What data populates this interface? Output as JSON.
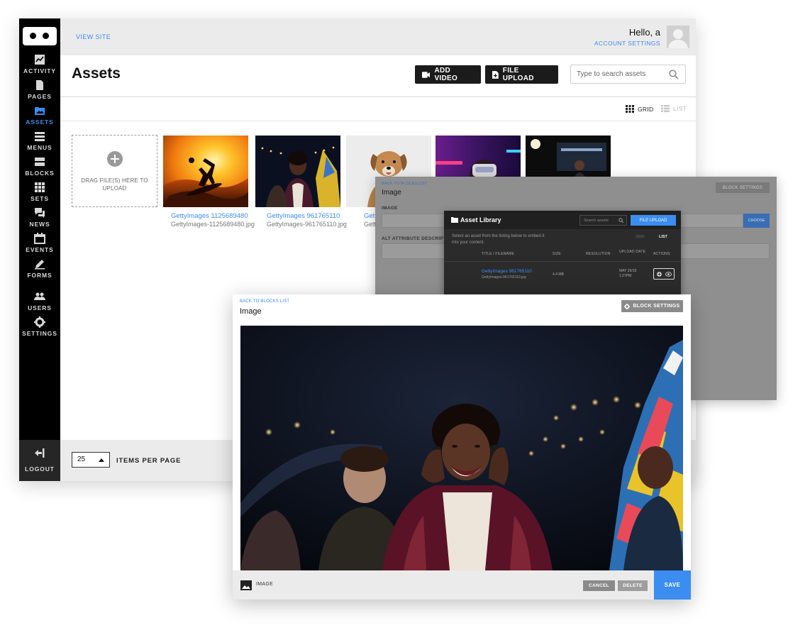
{
  "sidebar": {
    "items": [
      {
        "label": "ACTIVITY",
        "icon": "activity-icon"
      },
      {
        "label": "PAGES",
        "icon": "page-icon"
      },
      {
        "label": "ASSETS",
        "icon": "image-icon",
        "active": true
      },
      {
        "label": "MENUS",
        "icon": "menu-icon"
      },
      {
        "label": "BLOCKS",
        "icon": "blocks-icon"
      },
      {
        "label": "SETS",
        "icon": "grid-icon"
      },
      {
        "label": "NEWS",
        "icon": "chat-icon"
      },
      {
        "label": "EVENTS",
        "icon": "calendar-icon"
      },
      {
        "label": "FORMS",
        "icon": "pencil-icon"
      },
      {
        "label": "USERS",
        "icon": "users-icon"
      },
      {
        "label": "SETTINGS",
        "icon": "gear-icon"
      }
    ],
    "logout": "LOGOUT"
  },
  "topbar": {
    "view_site": "VIEW SITE",
    "greeting": "Hello, a",
    "account_settings": "ACCOUNT SETTINGS"
  },
  "header": {
    "title": "Assets",
    "add_video": "ADD VIDEO",
    "file_upload": "FILE UPLOAD",
    "search_placeholder": "Type to search assets"
  },
  "view_toggle": {
    "grid": "GRID",
    "list": "LIST",
    "selected": "grid"
  },
  "dropzone": {
    "text": "DRAG FILE(S) HERE TO UPLOAD"
  },
  "assets": [
    {
      "title": "GettyImages 1125689480",
      "file": "GettyImages-1125689480.jpg"
    },
    {
      "title": "GettyImages 961765110",
      "file": "GettyImages-961765110.jpg"
    },
    {
      "title": "Gett",
      "file": "Gett"
    }
  ],
  "footer": {
    "per_page_value": "25",
    "per_page_label": "ITEMS PER PAGE"
  },
  "block_panel": {
    "back": "BACK TO BLOCKS LIST",
    "title": "Image",
    "settings": "BLOCK SETTINGS",
    "image_label": "IMAGE",
    "choose": "CHOOSE",
    "alt_label": "ALT ATTRIBUTE DESCRIPT"
  },
  "asset_library": {
    "title": "Asset Library",
    "search_placeholder": "Search assets",
    "file_upload": "FILE UPLOAD",
    "description": "Select an asset from the listing below to embed it into your content.",
    "grid": "GRID",
    "list": "LIST",
    "columns": [
      "TITLE / FILENAME",
      "SIZE",
      "RESOLUTION",
      "UPLOAD DATE",
      "ACTIONS"
    ],
    "rows": [
      {
        "title": "GettyImages 961765110",
        "file": "GettyImages-961765110.jpg",
        "size": "4.4 MB",
        "date_line1": "MAY 29/19",
        "date_line2": "1:27PM"
      }
    ]
  },
  "image_editor": {
    "back": "BACK TO BLOCKS LIST",
    "title": "Image",
    "settings": "BLOCK SETTINGS",
    "type_label": "IMAGE",
    "cancel": "CANCEL",
    "delete": "DELETE",
    "save": "SAVE"
  },
  "colors": {
    "accent": "#3b8df1",
    "sidebar": "#000000",
    "button_dark": "#1b1b1b"
  }
}
